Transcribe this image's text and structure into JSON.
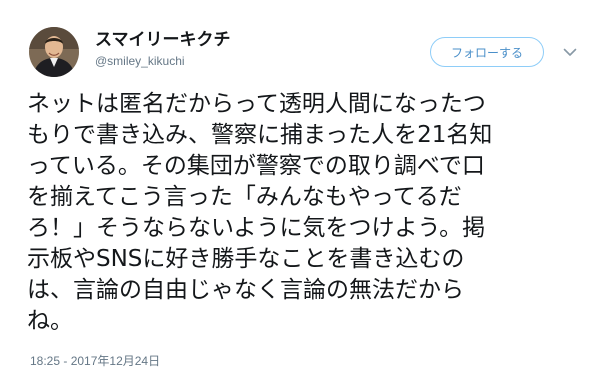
{
  "user": {
    "display_name": "スマイリーキクチ",
    "handle": "@smiley_kikuchi"
  },
  "follow_button": {
    "label": "フォローする"
  },
  "more_menu": {
    "icon": "chevron-down-icon"
  },
  "tweet": {
    "lines": [
      "ネットは匿名だからって透明人間になったつ",
      "もりで書き込み、警察に捕まった人を21名知",
      "っている。その集団が警察での取り調べで口",
      "を揃えてこう言った「みんなもやってるだ",
      "ろ！」そうならないように気をつけよう。掲",
      "示板やSNSに好き勝手なことを書き込むの",
      "は、言論の自由じゃなく言論の無法だから",
      "ね。"
    ],
    "timestamp": "18:25 - 2017年12月24日"
  },
  "colors": {
    "link_blue": "#4a8fc9",
    "follow_border": "#8ecdf8",
    "secondary_text": "#657786",
    "primary_text": "#14171a"
  }
}
